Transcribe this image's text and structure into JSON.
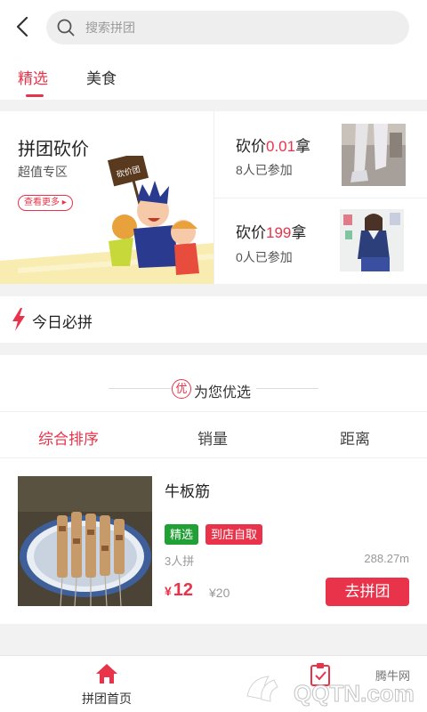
{
  "search": {
    "placeholder": "搜索拼团"
  },
  "tabs": [
    {
      "label": "精选"
    },
    {
      "label": "美食"
    }
  ],
  "promo": {
    "title": "拼团砍价",
    "subtitle": "超值专区",
    "more_label": "查看更多",
    "sign_text": "砍价团",
    "deals": [
      {
        "prefix": "砍价",
        "price": "0.01",
        "suffix": "拿",
        "joined": "8人已参加"
      },
      {
        "prefix": "砍价",
        "price": "199",
        "suffix": "拿",
        "joined": "0人已参加"
      }
    ]
  },
  "today": {
    "title": "今日必拼"
  },
  "recommend": {
    "badge": "优",
    "title": "为您优选",
    "sort_options": [
      {
        "label": "综合排序"
      },
      {
        "label": "销量"
      },
      {
        "label": "距离"
      }
    ]
  },
  "product": {
    "name": "牛板筋",
    "tags": [
      "精选",
      "到店自取"
    ],
    "sold": "3人拼",
    "distance": "288.27m",
    "currency": "¥",
    "price": "12",
    "original_price": "¥20",
    "button_label": "去拼团"
  },
  "bottom_nav": {
    "home_label": "拼团首页"
  },
  "watermark": {
    "brand": "腾牛网",
    "site": "QQTN.com"
  },
  "colors": {
    "accent": "#e8334a",
    "green_tag": "#21a036"
  }
}
